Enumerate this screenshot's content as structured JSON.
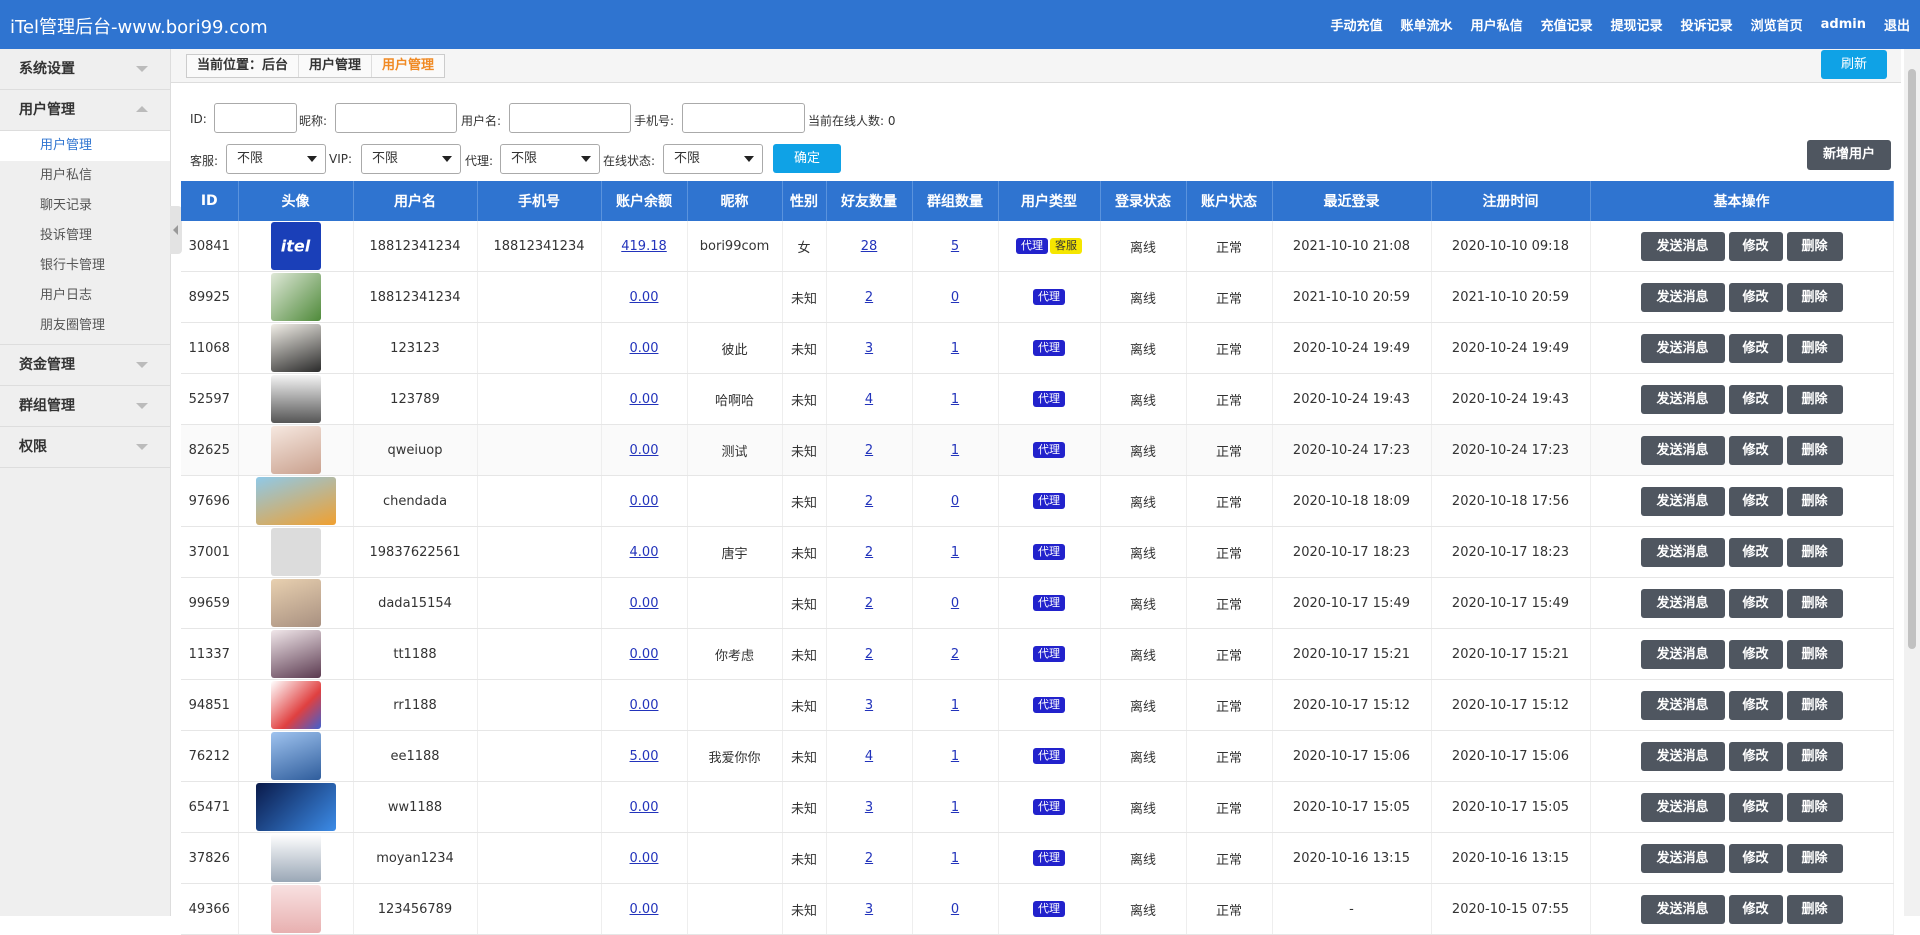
{
  "app": {
    "brand": "iTel管理后台-www.bori99.com",
    "nav": [
      "手动充值",
      "账单流水",
      "用户私信",
      "充值记录",
      "提现记录",
      "投诉记录",
      "浏览首页",
      "admin",
      "退出"
    ]
  },
  "sidebar": {
    "groups": [
      {
        "label": "系统设置",
        "open": false
      },
      {
        "label": "用户管理",
        "open": true,
        "items": [
          "用户管理",
          "用户私信",
          "聊天记录",
          "投诉管理",
          "银行卡管理",
          "用户日志",
          "朋友圈管理"
        ],
        "active": "用户管理"
      },
      {
        "label": "资金管理",
        "open": false
      },
      {
        "label": "群组管理",
        "open": false
      },
      {
        "label": "权限",
        "open": false
      }
    ]
  },
  "breadcrumb": [
    "当前位置：后台",
    "用户管理",
    "用户管理"
  ],
  "refresh_label": "刷新",
  "filters": {
    "id_label": "ID:",
    "nick_label": "昵称:",
    "username_label": "用户名:",
    "phone_label": "手机号:",
    "online_count": "当前在线人数: 0",
    "cs_label": "客服:",
    "vip_label": "VIP:",
    "agent_label": "代理:",
    "online_label": "在线状态:",
    "select_value": "不限",
    "confirm_label": "确定",
    "add_user_label": "新增用户"
  },
  "table": {
    "headers": [
      "ID",
      "头像",
      "用户名",
      "手机号",
      "账户余额",
      "昵称",
      "性别",
      "好友数量",
      "群组数量",
      "用户类型",
      "登录状态",
      "账户状态",
      "最近登录",
      "注册时间",
      "基本操作"
    ],
    "actions": {
      "send": "发送消息",
      "edit": "修改",
      "delete": "删除"
    },
    "tag_agent": "代理",
    "tag_cs": "客服",
    "rows": [
      {
        "id": "30841",
        "avatar": "intel",
        "avatar_text": "itel",
        "username": "18812341234",
        "phone": "18812341234",
        "balance": "419.18",
        "nick": "bori99com",
        "gender": "女",
        "friends": "28",
        "groups": "5",
        "cs": true,
        "login": "离线",
        "status": "正常",
        "last": "2021-10-10 21:08",
        "reg": "2020-10-10 09:18"
      },
      {
        "id": "89925",
        "avatar": "leaf",
        "username": "18812341234",
        "phone": "",
        "balance": "0.00",
        "nick": "",
        "gender": "未知",
        "friends": "2",
        "groups": "0",
        "cs": false,
        "login": "离线",
        "status": "正常",
        "last": "2021-10-10 20:59",
        "reg": "2021-10-10 20:59"
      },
      {
        "id": "11068",
        "avatar": "girl",
        "username": "123123",
        "phone": "",
        "balance": "0.00",
        "nick": "彼此",
        "gender": "未知",
        "friends": "3",
        "groups": "1",
        "cs": false,
        "login": "离线",
        "status": "正常",
        "last": "2020-10-24 19:49",
        "reg": "2020-10-24 19:49"
      },
      {
        "id": "52597",
        "avatar": "ink",
        "username": "123789",
        "phone": "",
        "balance": "0.00",
        "nick": "哈啊哈",
        "gender": "未知",
        "friends": "4",
        "groups": "1",
        "cs": false,
        "login": "离线",
        "status": "正常",
        "last": "2020-10-24 19:43",
        "reg": "2020-10-24 19:43"
      },
      {
        "id": "82625",
        "avatar": "lady",
        "username": "qweiuop",
        "phone": "",
        "balance": "0.00",
        "nick": "测试",
        "gender": "未知",
        "friends": "2",
        "groups": "1",
        "cs": false,
        "login": "离线",
        "status": "正常",
        "last": "2020-10-24 17:23",
        "reg": "2020-10-24 17:23"
      },
      {
        "id": "97696",
        "avatar": "penguin",
        "username": "chendada",
        "phone": "",
        "balance": "0.00",
        "nick": "",
        "gender": "未知",
        "friends": "2",
        "groups": "0",
        "cs": false,
        "login": "离线",
        "status": "正常",
        "last": "2020-10-18 18:09",
        "reg": "2020-10-18 17:56"
      },
      {
        "id": "37001",
        "avatar": "default",
        "username": "19837622561",
        "phone": "",
        "balance": "4.00",
        "nick": "唐宇",
        "gender": "未知",
        "friends": "2",
        "groups": "1",
        "cs": false,
        "login": "离线",
        "status": "正常",
        "last": "2020-10-17 18:23",
        "reg": "2020-10-17 18:23"
      },
      {
        "id": "99659",
        "avatar": "cat",
        "username": "dada15154",
        "phone": "",
        "balance": "0.00",
        "nick": "",
        "gender": "未知",
        "friends": "2",
        "groups": "0",
        "cs": false,
        "login": "离线",
        "status": "正常",
        "last": "2020-10-17 15:49",
        "reg": "2020-10-17 15:49"
      },
      {
        "id": "11337",
        "avatar": "anime",
        "username": "tt1188",
        "phone": "",
        "balance": "0.00",
        "nick": "你考虑",
        "gender": "未知",
        "friends": "2",
        "groups": "2",
        "cs": false,
        "login": "离线",
        "status": "正常",
        "last": "2020-10-17 15:21",
        "reg": "2020-10-17 15:21"
      },
      {
        "id": "94851",
        "avatar": "rocket",
        "username": "rr1188",
        "phone": "",
        "balance": "0.00",
        "nick": "",
        "gender": "未知",
        "friends": "3",
        "groups": "1",
        "cs": false,
        "login": "离线",
        "status": "正常",
        "last": "2020-10-17 15:12",
        "reg": "2020-10-17 15:12"
      },
      {
        "id": "76212",
        "avatar": "blue",
        "username": "ee1188",
        "phone": "",
        "balance": "5.00",
        "nick": "我爱你你",
        "gender": "未知",
        "friends": "4",
        "groups": "1",
        "cs": false,
        "login": "离线",
        "status": "正常",
        "last": "2020-10-17 15:06",
        "reg": "2020-10-17 15:06"
      },
      {
        "id": "65471",
        "avatar": "conan",
        "username": "ww1188",
        "phone": "",
        "balance": "0.00",
        "nick": "",
        "gender": "未知",
        "friends": "3",
        "groups": "1",
        "cs": false,
        "login": "离线",
        "status": "正常",
        "last": "2020-10-17 15:05",
        "reg": "2020-10-17 15:05"
      },
      {
        "id": "37826",
        "avatar": "smoke",
        "username": "moyan1234",
        "phone": "",
        "balance": "0.00",
        "nick": "",
        "gender": "未知",
        "friends": "2",
        "groups": "1",
        "cs": false,
        "login": "离线",
        "status": "正常",
        "last": "2020-10-16 13:15",
        "reg": "2020-10-16 13:15"
      },
      {
        "id": "49366",
        "avatar": "pink",
        "username": "123456789",
        "phone": "",
        "balance": "0.00",
        "nick": "",
        "gender": "未知",
        "friends": "3",
        "groups": "0",
        "cs": false,
        "login": "离线",
        "status": "正常",
        "last": "-",
        "reg": "2020-10-15 07:55"
      }
    ]
  }
}
